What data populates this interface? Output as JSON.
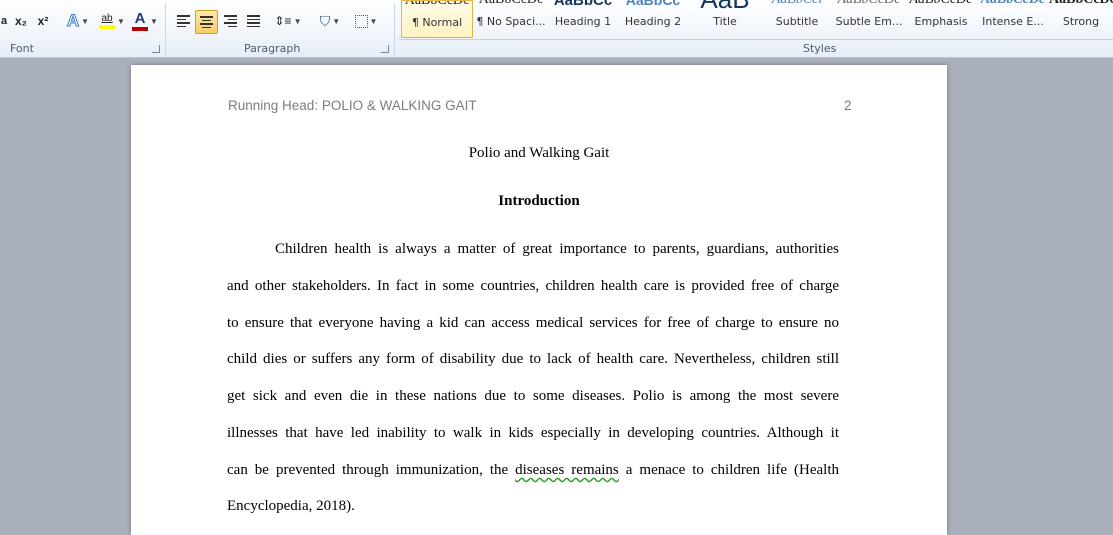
{
  "ribbon": {
    "font_group_label": "Font",
    "paragraph_group_label": "Paragraph",
    "styles_group_label": "Styles",
    "font_buttons": {
      "subscript": "x₂",
      "superscript": "x²",
      "text_effects": "A",
      "highlight": "ab",
      "font_color": "A"
    },
    "styles": [
      {
        "sample": "AaBbCcDc",
        "name": "¶ Normal",
        "selected": true
      },
      {
        "sample": "AaBbCcDc",
        "name": "¶ No Spaci..."
      },
      {
        "sample": "AaBbCc",
        "name": "Heading 1"
      },
      {
        "sample": "AaBbCc",
        "name": "Heading 2"
      },
      {
        "sample": "AaB",
        "name": "Title"
      },
      {
        "sample": "AaBbCcl",
        "name": "Subtitle"
      },
      {
        "sample": "AaBbCcDc",
        "name": "Subtle Em..."
      },
      {
        "sample": "AaBbCcDc",
        "name": "Emphasis"
      },
      {
        "sample": "AaBbCcDc",
        "name": "Intense E..."
      },
      {
        "sample": "AaBbCcDc",
        "name": "Strong"
      }
    ],
    "colors": {
      "highlight_bar": "#ffff00",
      "font_color_bar": "#c00000",
      "heading_blue": "#17365d"
    }
  },
  "document": {
    "header_left": "Running Head: POLIO & WALKING GAIT",
    "page_number": "2",
    "title": "Polio and Walking Gait",
    "heading": "Introduction",
    "paragraph_lines": [
      "Children health is always a matter of great importance to parents, guardians, authorities",
      "and other stakeholders. In fact in some countries, children health care is provided free of charge",
      "to ensure that everyone having a kid can access medical services for free of charge to ensure no",
      "child dies or suffers any form of disability due to lack of health care. Nevertheless, children still",
      "get sick and even die in these nations due to some diseases. Polio is among the most severe",
      "illnesses that have led inability to walk in kids especially in developing countries. Although it",
      "can be prevented through immunization, the ",
      "Encyclopedia, 2018)."
    ],
    "squiggle_text": "diseases remains",
    "line7_tail": " a menace to children life (Health"
  }
}
